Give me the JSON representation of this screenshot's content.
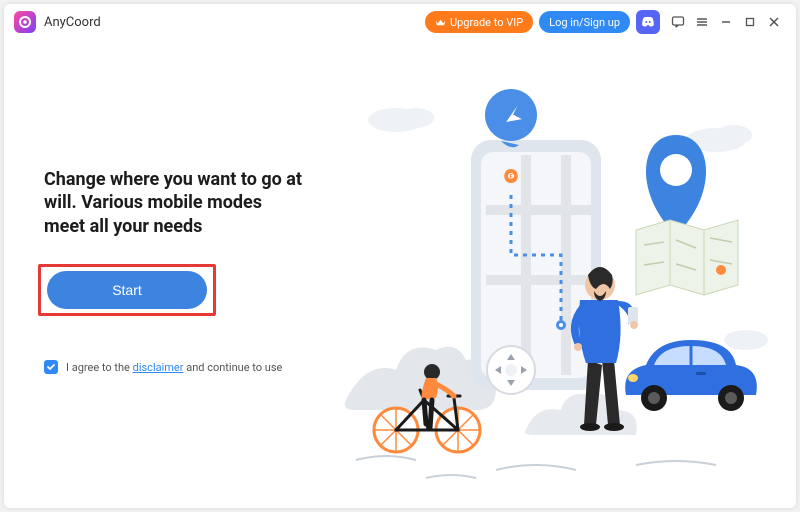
{
  "app": {
    "title": "AnyCoord"
  },
  "titlebar": {
    "upgrade_label": "Upgrade to VIP",
    "login_label": "Log in/Sign up"
  },
  "main": {
    "headline": "Change where you want to go at will. Various mobile modes meet all your needs",
    "start_label": "Start"
  },
  "footer": {
    "agree_prefix": "I agree to the ",
    "disclaimer_link": "disclaimer",
    "agree_suffix": " and continue to use"
  },
  "colors": {
    "accent": "#2f8af5",
    "start_button": "#3d84e0",
    "upgrade": "#ff7a1a",
    "highlight_box": "#e53935",
    "discord": "#5865F2"
  }
}
